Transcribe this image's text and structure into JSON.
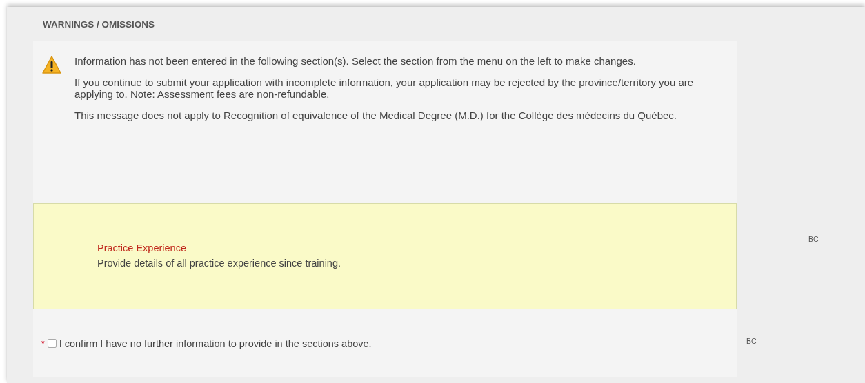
{
  "section": {
    "title": "WARNINGS / OMISSIONS"
  },
  "warning": {
    "paragraphs": [
      "Information has not been entered in the following section(s). Select the section from the menu on the left to make changes.",
      "If you continue to submit your application with incomplete information, your application may be rejected by the province/territory you are applying to. Note: Assessment fees are non-refundable.",
      "This message does not apply to Recognition of equivalence of the Medical Degree (M.D.) for the Collège des médecins du Québec."
    ]
  },
  "omissions": [
    {
      "title": "Practice Experience",
      "description": "Provide details of all practice experience since training.",
      "code": "BC"
    }
  ],
  "confirmation": {
    "required_marker": "*",
    "checked": false,
    "label": "I confirm I have no further information to provide in the sections above.",
    "code": "BC"
  }
}
